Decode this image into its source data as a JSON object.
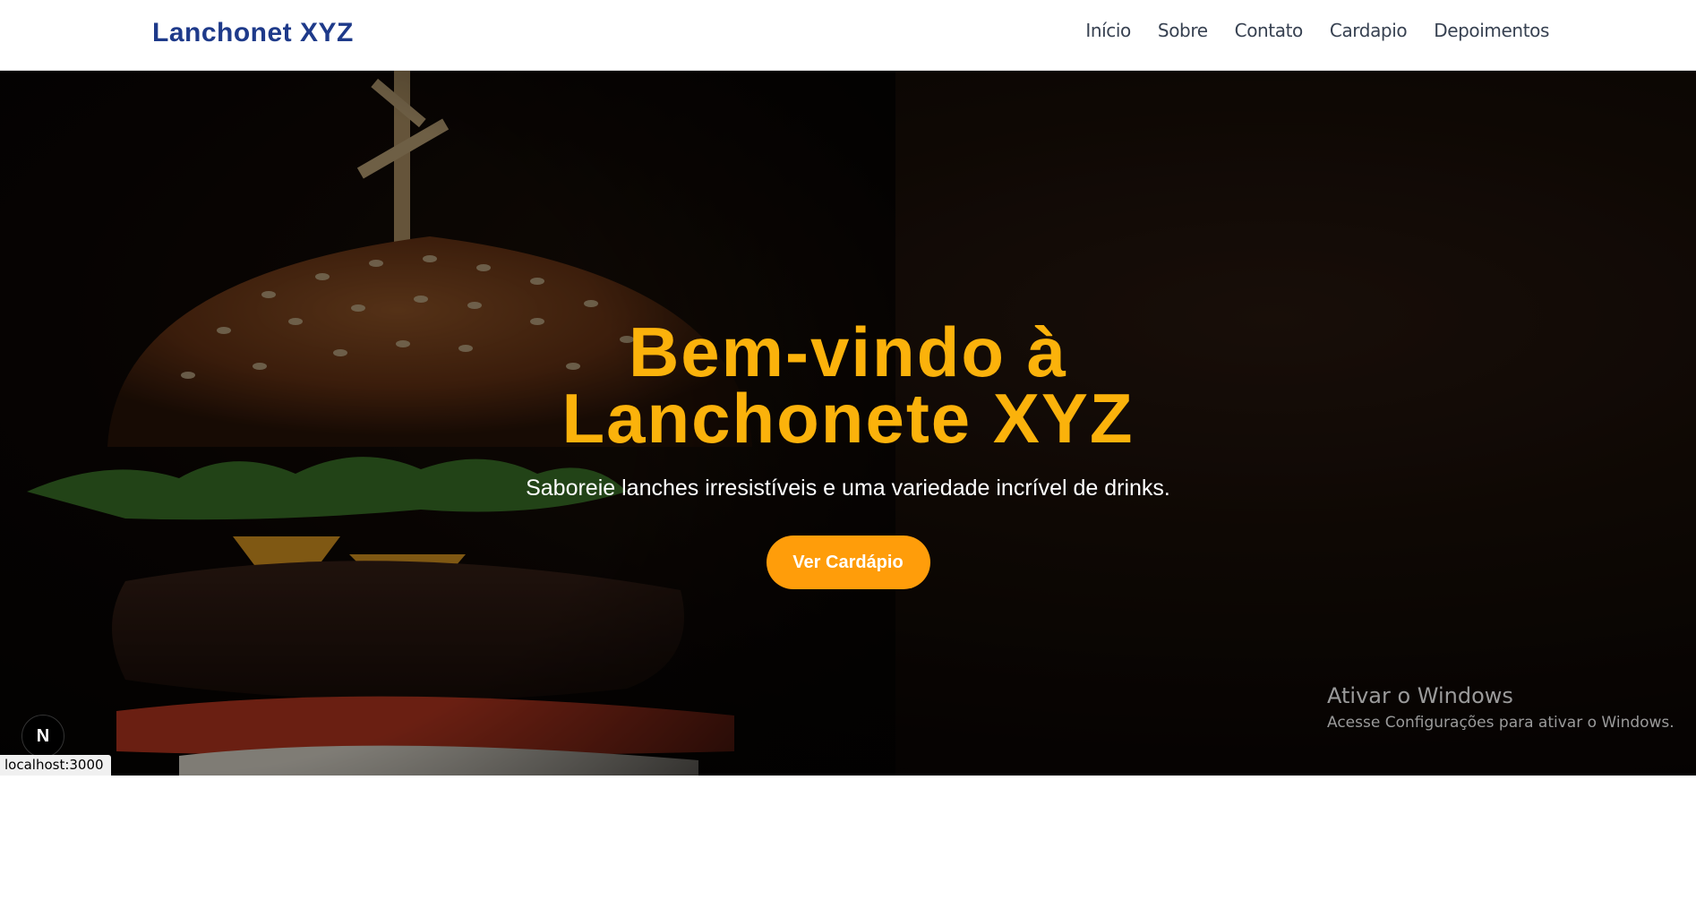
{
  "header": {
    "brand": "Lanchonet XYZ",
    "nav": [
      "Início",
      "Sobre",
      "Contato",
      "Cardapio",
      "Depoimentos"
    ]
  },
  "hero": {
    "title_line1": "Bem-vindo à",
    "title_line2": "Lanchonete XYZ",
    "subtitle": "Saboreie lanches irresistíveis e uma variedade incrível de drinks.",
    "cta_label": "Ver Cardápio",
    "image_icon": "burger-photo"
  },
  "windows_watermark": {
    "title": "Ativar o Windows",
    "subtitle": "Acesse Configurações para ativar o Windows."
  },
  "dev_badge": {
    "letter": "N",
    "icon": "nextjs-logo-icon"
  },
  "status_bar": {
    "url": "localhost:3000"
  },
  "colors": {
    "brand": "#1e3a8a",
    "nav_text": "#374151",
    "hero_title": "#fbb20b",
    "cta_bg": "#ff9d0a",
    "hero_bg": "#0b0604"
  }
}
